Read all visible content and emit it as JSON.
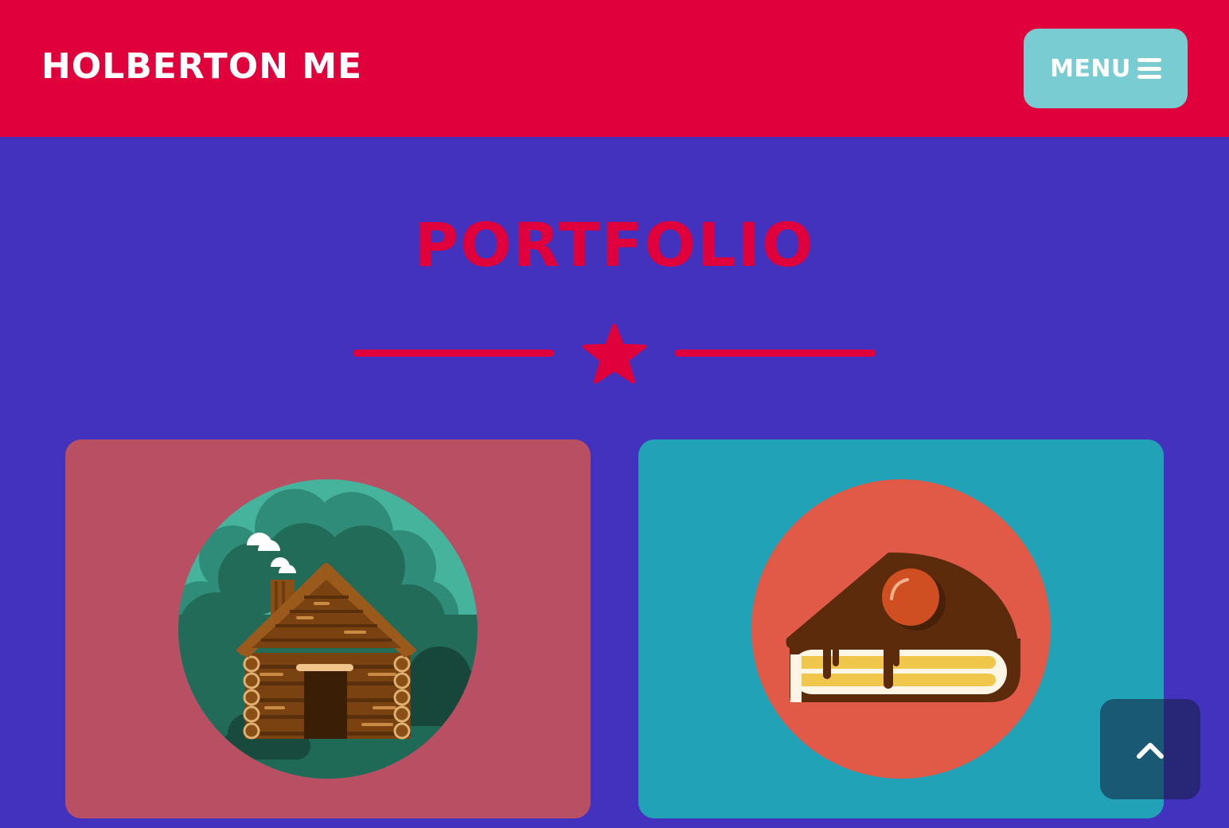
{
  "navbar": {
    "brand": "HOLBERTON ME",
    "menu_label": "MENU",
    "menu_icon": "hamburger-icon"
  },
  "portfolio": {
    "title": "PORTFOLIO",
    "divider_icon": "star-icon",
    "items": [
      {
        "icon": "log-cabin-icon"
      },
      {
        "icon": "cake-slice-icon"
      }
    ]
  },
  "scroll_top": {
    "icon": "chevron-up-icon"
  },
  "colors": {
    "primary": "#e0003c",
    "background": "#4232be",
    "menu_button": "#78ccd2",
    "card_cabin": "#b94f63",
    "card_cake": "#22a2b6"
  }
}
